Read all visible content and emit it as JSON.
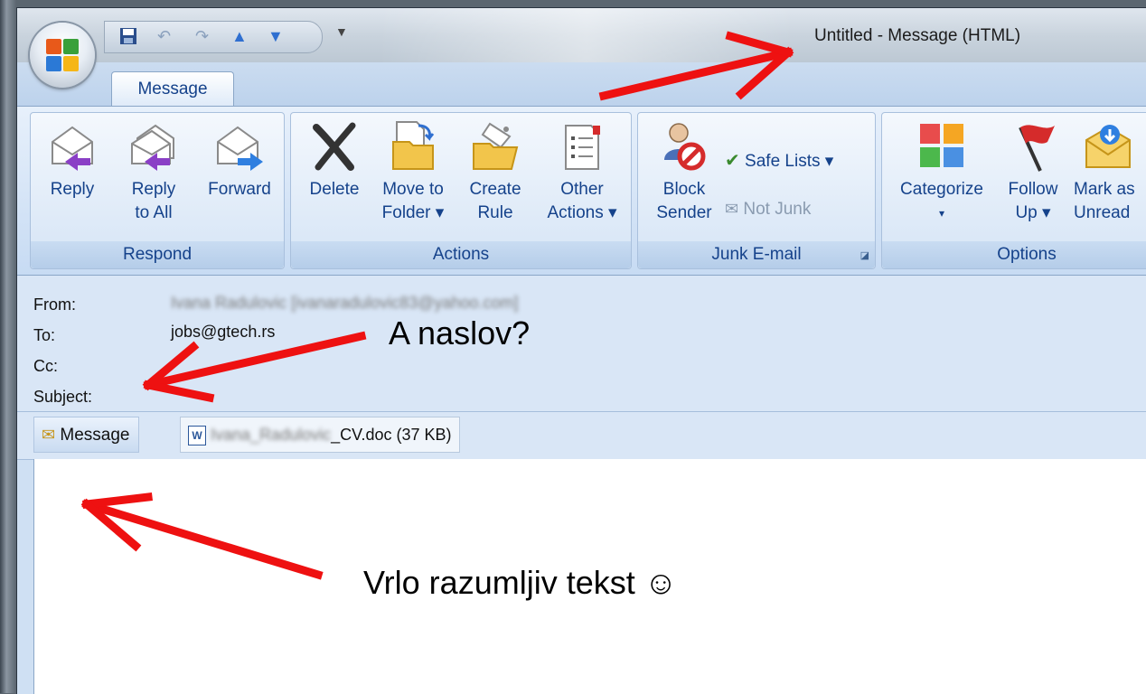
{
  "window": {
    "title": "Untitled - Message (HTML)"
  },
  "quick_access": {
    "icons": [
      "save-icon",
      "undo-icon",
      "redo-icon",
      "previous-item-icon",
      "next-item-icon"
    ],
    "dropdown_glyph": "▼"
  },
  "tabs": [
    {
      "label": "Message"
    }
  ],
  "ribbon": {
    "respond": {
      "title": "Respond",
      "reply": {
        "line1": "Reply"
      },
      "reply_all": {
        "line1": "Reply",
        "line2": "to All"
      },
      "forward": {
        "line1": "Forward"
      }
    },
    "actions": {
      "title": "Actions",
      "delete": {
        "line1": "Delete"
      },
      "move": {
        "line1": "Move to",
        "line2": "Folder ▾"
      },
      "rule": {
        "line1": "Create",
        "line2": "Rule"
      },
      "other": {
        "line1": "Other",
        "line2": "Actions ▾"
      }
    },
    "junk": {
      "title": "Junk E-mail",
      "block": {
        "line1": "Block",
        "line2": "Sender"
      },
      "safe_lists": "Safe Lists ▾",
      "not_junk": "Not Junk"
    },
    "options": {
      "title": "Options",
      "categorize": {
        "line1": "Categorize",
        "line2": "▾"
      },
      "follow_up": {
        "line1": "Follow",
        "line2": "Up ▾"
      },
      "mark_unread": {
        "line1": "Mark as",
        "line2": "Unread"
      }
    }
  },
  "header": {
    "from_label": "From:",
    "from_value": "Ivana Radulovic [ivanaradulovic83@yahoo.com]",
    "to_label": "To:",
    "to_value": "jobs@gtech.rs",
    "cc_label": "Cc:",
    "subject_label": "Subject:",
    "subject_value": ""
  },
  "attachments": {
    "message_tab": "Message",
    "file_blurred": "Ivana_Radulovic",
    "file_suffix": "_CV.doc (37 KB)"
  },
  "annotations": {
    "subject_note": "A naslov?",
    "body_note": "Vrlo razumljiv tekst ☺"
  },
  "colors": {
    "arrow": "#ee1111",
    "ribbon_text": "#15428b"
  }
}
